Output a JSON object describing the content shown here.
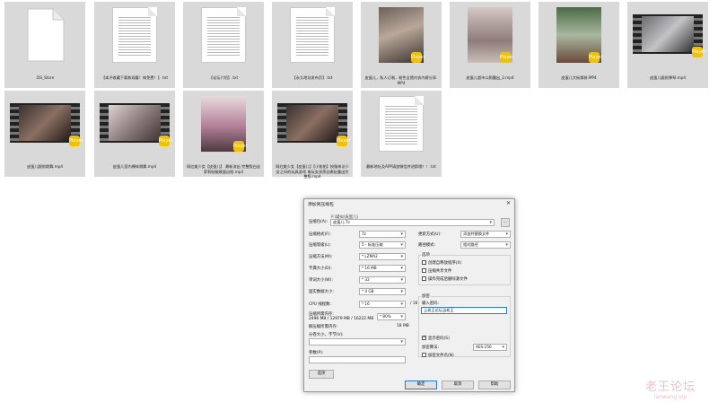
{
  "files": [
    {
      "name": ".DS_Store"
    },
    {
      "name": "【本子收藏下载和观看！纯免费！】.txt"
    },
    {
      "name": "【论坛介绍】.txt"
    },
    {
      "name": "【永久地址发布页】.txt"
    },
    {
      "name": "皮蛋儿，私人订制，粉色全透内衣内裤分享.MP4",
      "badge": "Player"
    },
    {
      "name": "皮蛋儿超市公厕露出_2.mp4",
      "badge": "Player"
    },
    {
      "name": "皮蛋儿大街换装.MP4",
      "badge": "Player"
    },
    {
      "name": "皮蛋儿跟前弹琴.mp4",
      "badge": "Player"
    },
    {
      "name": "皮蛋儿跟前跳舞.mp4",
      "badge": "Player"
    },
    {
      "name": "皮蛋儿室内裸体跳舞.mp4",
      "badge": "Player"
    },
    {
      "name": "网红美少女【皮蛋儿】 最新流出 完整版白丝萝莉制服跳蛋自慰.mp4",
      "badge": "Player"
    },
    {
      "name": "网红美少女【皮蛋儿】【小佑佑】校服来访少女之间的玩具游戏 电玩女孩黑丝撕扯露出完整版.mp4",
      "badge": "Player"
    },
    {
      "name": "最新地址及APP请加微信并进群哦！！.txt"
    }
  ],
  "dialog": {
    "title": "添加到压缩包",
    "close": "✕",
    "archive_label": "压缩包(A):",
    "archive_path_hint": "F:\\疑似\\皮蛋儿\\",
    "archive_value": "皮蛋儿.7z",
    "browse": "...",
    "format_label": "压缩格式(F):",
    "format_value": "7z",
    "level_label": "压缩等级(L):",
    "level_value": "5 - 标准压缩",
    "method_label": "压缩方法(M):",
    "method_value": "* LZMA2",
    "dict_label": "字典大小(D):",
    "dict_value": "* 16 MB",
    "word_label": "单词大小(W):",
    "word_value": "* 32",
    "solid_label": "固实数据大小:",
    "solid_value": "* 4 GB",
    "cpu_label": "CPU 线程数:",
    "cpu_value": "* 16",
    "cpu_total": "/ 16",
    "memory_label": "压缩所需内存:",
    "memory_value": "2496 MB / 12979 MB / 16222 MB",
    "memory_percent": "* 80%",
    "decomp_label": "解压缩所需内存:",
    "decomp_value": "18 MB",
    "split_label": "分卷大小，字节(V):",
    "split_value": "",
    "params_label": "参数(P):",
    "params_value": "",
    "options_button": "选项",
    "update_label": "更新方式(U):",
    "update_value": "添加并替换文件",
    "path_label": "路径模式:",
    "path_value": "相对路径",
    "options_group": "选项",
    "opt1": "创建自释放程序(X)",
    "opt2": "压缩共享文件",
    "opt3": "操作完成后删除源文件",
    "encrypt_group": "加密",
    "pwd_label": "输入密码:",
    "pwd_value": "上老王论坛当老王",
    "show_pwd": "显示密码(S)",
    "enc_method_label": "加密算法:",
    "enc_method_value": "AES-256",
    "encrypt_names": "加密文件名(N)",
    "ok": "确定",
    "cancel": "取消",
    "help": "帮助"
  },
  "watermark": {
    "line1": "老王论坛",
    "line2": "laowang.vip"
  }
}
